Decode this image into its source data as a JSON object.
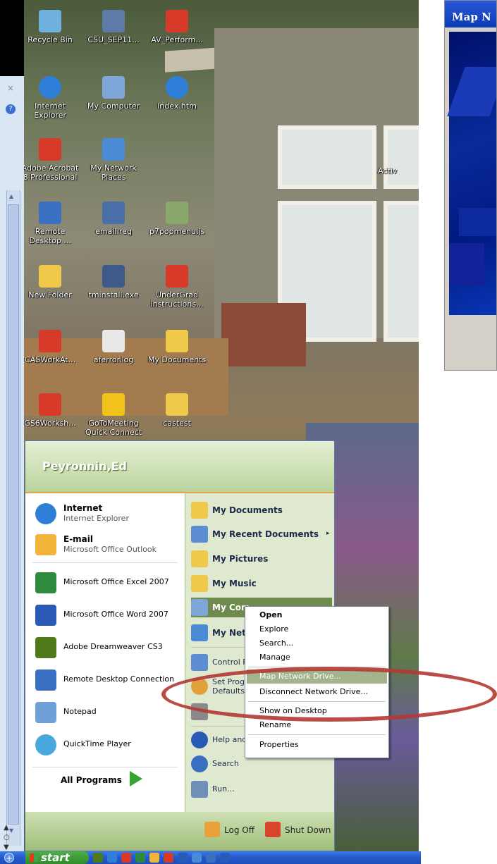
{
  "sidebar": {
    "close_glyph": "×",
    "help_glyph": "?",
    "scroll_up": "▲",
    "scroll_down": "▼",
    "bottom_controls": [
      "▲",
      "○",
      "▼"
    ]
  },
  "desktop_icons": [
    {
      "label": "Recycle Bin",
      "icon": "recycle-bin-icon",
      "color": "#6fb1de"
    },
    {
      "label": "CSU_SEP11...",
      "icon": "package-icon",
      "color": "#5d7aa8"
    },
    {
      "label": "AV_Perform...",
      "icon": "pdf-icon",
      "color": "#d83a2a"
    },
    {
      "label": "Internet Explorer",
      "icon": "internet-explorer-icon",
      "color": "#2f7fd9"
    },
    {
      "label": "My Computer",
      "icon": "my-computer-icon",
      "color": "#7ea6d8"
    },
    {
      "label": "index.htm",
      "icon": "internet-explorer-icon",
      "color": "#2f7fd9"
    },
    {
      "label": "Adobe Acrobat 8 Professional",
      "icon": "acrobat-icon",
      "color": "#d83a2a"
    },
    {
      "label": "My Network Places",
      "icon": "network-places-icon",
      "color": "#4a8bd6"
    },
    {
      "label": "Activ",
      "icon": "",
      "color": ""
    },
    {
      "label": "Remote Desktop ...",
      "icon": "remote-desktop-icon",
      "color": "#3b6fc2"
    },
    {
      "label": "email.reg",
      "icon": "registry-icon",
      "color": "#4a6fa8"
    },
    {
      "label": "p7popmenu.js",
      "icon": "script-icon",
      "color": "#8aa86b"
    },
    {
      "label": "New Folder",
      "icon": "folder-icon",
      "color": "#f0c84a"
    },
    {
      "label": "tminstall.exe",
      "icon": "installer-icon",
      "color": "#3e5a8a"
    },
    {
      "label": "UnderGrad instructions...",
      "icon": "pdf-icon",
      "color": "#d83a2a"
    },
    {
      "label": "CASWorkAt...",
      "icon": "pdf-icon",
      "color": "#d83a2a"
    },
    {
      "label": "aferror.log",
      "icon": "text-file-icon",
      "color": "#e8e8e8"
    },
    {
      "label": "My Documents",
      "icon": "my-documents-icon",
      "color": "#f0c84a"
    },
    {
      "label": "GS6Worksh...",
      "icon": "pdf-icon",
      "color": "#d83a2a"
    },
    {
      "label": "GoToMeeting Quick Connect",
      "icon": "gotomeeting-icon",
      "color": "#f2c21a"
    },
    {
      "label": "castest",
      "icon": "folder-icon",
      "color": "#f0c84a"
    }
  ],
  "map_window": {
    "title": "Map N"
  },
  "start_menu": {
    "user": "Peyronnin,Ed",
    "pinned": [
      {
        "title": "Internet",
        "subtitle": "Internet Explorer",
        "icon": "internet-explorer-icon",
        "color": "#2f7fd9"
      },
      {
        "title": "E-mail",
        "subtitle": "Microsoft Office Outlook",
        "icon": "outlook-icon",
        "color": "#f2b43a"
      }
    ],
    "recent": [
      {
        "label": "Microsoft Office Excel 2007",
        "icon": "excel-icon",
        "color": "#2e8b3e"
      },
      {
        "label": "Microsoft Office Word 2007",
        "icon": "word-icon",
        "color": "#2a5ab8"
      },
      {
        "label": "Adobe Dreamweaver CS3",
        "icon": "dreamweaver-icon",
        "color": "#4f7a1c"
      },
      {
        "label": "Remote Desktop Connection",
        "icon": "remote-desktop-icon",
        "color": "#3b6fc2"
      },
      {
        "label": "Notepad",
        "icon": "notepad-icon",
        "color": "#6fa0d8"
      },
      {
        "label": "QuickTime Player",
        "icon": "quicktime-icon",
        "color": "#4aa8e0"
      }
    ],
    "all_programs": "All Programs",
    "right_items": [
      {
        "label": "My Documents",
        "icon": "my-documents-icon",
        "color": "#f0c84a",
        "bold": true
      },
      {
        "label": "My Recent Documents",
        "icon": "recent-documents-icon",
        "color": "#5d8ed1",
        "bold": true,
        "arrow": "▸"
      },
      {
        "label": "My Pictures",
        "icon": "my-pictures-icon",
        "color": "#f0c84a",
        "bold": true
      },
      {
        "label": "My Music",
        "icon": "my-music-icon",
        "color": "#f0c84a",
        "bold": true
      },
      {
        "label": "My Com",
        "icon": "my-computer-icon",
        "color": "#7ea6d8",
        "bold": true,
        "highlight": true
      },
      {
        "label": "My Net",
        "icon": "network-places-icon",
        "color": "#4a8bd6",
        "bold": true
      },
      {
        "label": "Control P",
        "icon": "control-panel-icon",
        "color": "#5d8ed1",
        "bold": false
      },
      {
        "label": "Set Prog",
        "label2": "Defaults",
        "icon": "set-program-defaults-icon",
        "color": "#e0a03a",
        "bold": false
      },
      {
        "label": "",
        "icon": "printers-icon",
        "color": "#8a8a8a",
        "bold": false
      },
      {
        "label": "Help and",
        "icon": "help-icon",
        "color": "#2a5ab8",
        "bold": false
      },
      {
        "label": "Search",
        "icon": "search-icon",
        "color": "#3b6fc2",
        "bold": false
      },
      {
        "label": "Run...",
        "icon": "run-icon",
        "color": "#6f8fb8",
        "bold": false
      }
    ],
    "logoff": "Log Off",
    "shutdown": "Shut Down"
  },
  "context_menu": {
    "items": [
      {
        "label": "Open",
        "bold": true
      },
      {
        "label": "Explore"
      },
      {
        "label": "Search..."
      },
      {
        "label": "Manage"
      },
      {
        "label": "Map Network Drive...",
        "highlight": true
      },
      {
        "label": "Disconnect Network Drive..."
      },
      {
        "label": "Show on Desktop"
      },
      {
        "label": "Rename"
      },
      {
        "label": "Properties"
      }
    ]
  },
  "taskbar": {
    "start_label": "start",
    "plus_glyph": "+",
    "quicklaunch_colors": [
      "#4f7a1c",
      "#2f7fd9",
      "#d83a2a",
      "#2e8b3e",
      "#f2b43a",
      "#d83a2a",
      "#2a5ab8",
      "#4a8bd6",
      "#3b6fc2",
      "#2a5ab8"
    ]
  },
  "colors": {
    "annotation": "#b23a33",
    "xp_blue": "#2457c9",
    "start_green": "#34a52f"
  }
}
